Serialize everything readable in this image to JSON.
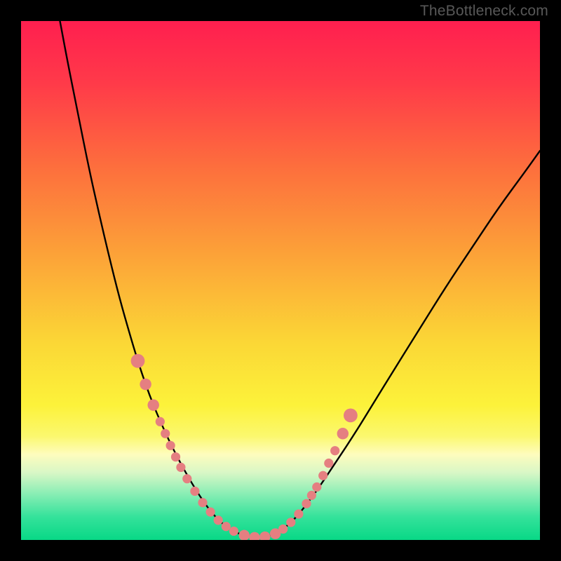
{
  "watermark": "TheBottleneck.com",
  "colors": {
    "frame": "#000000",
    "gradient_stops": [
      {
        "offset": 0.0,
        "color": "#ff1f4f"
      },
      {
        "offset": 0.12,
        "color": "#ff3a49"
      },
      {
        "offset": 0.28,
        "color": "#fd6e3d"
      },
      {
        "offset": 0.45,
        "color": "#fca238"
      },
      {
        "offset": 0.62,
        "color": "#fbd736"
      },
      {
        "offset": 0.74,
        "color": "#fcf23a"
      },
      {
        "offset": 0.8,
        "color": "#fbf86e"
      },
      {
        "offset": 0.835,
        "color": "#fefcbd"
      },
      {
        "offset": 0.87,
        "color": "#d9f7c6"
      },
      {
        "offset": 0.91,
        "color": "#8beeb5"
      },
      {
        "offset": 0.955,
        "color": "#35e29b"
      },
      {
        "offset": 1.0,
        "color": "#08d886"
      }
    ],
    "curve": "#000000",
    "marker_fill": "#e57f81",
    "marker_stroke": "#e57f81"
  },
  "chart_data": {
    "type": "line",
    "title": "",
    "xlabel": "",
    "ylabel": "",
    "xlim": [
      0,
      1
    ],
    "ylim": [
      0,
      1
    ],
    "note": "Axes are normalized to the plot area; no tick labels are rendered.",
    "series": [
      {
        "name": "bottleneck-curve",
        "x": [
          0.075,
          0.09,
          0.11,
          0.13,
          0.15,
          0.17,
          0.19,
          0.21,
          0.225,
          0.24,
          0.255,
          0.27,
          0.285,
          0.3,
          0.315,
          0.33,
          0.345,
          0.36,
          0.375,
          0.39,
          0.4,
          0.415,
          0.43,
          0.45,
          0.47,
          0.49,
          0.515,
          0.54,
          0.57,
          0.6,
          0.64,
          0.68,
          0.72,
          0.77,
          0.82,
          0.87,
          0.92,
          0.97,
          1.0
        ],
        "y": [
          1.0,
          0.92,
          0.82,
          0.72,
          0.63,
          0.545,
          0.465,
          0.395,
          0.345,
          0.3,
          0.26,
          0.225,
          0.192,
          0.162,
          0.134,
          0.108,
          0.084,
          0.062,
          0.044,
          0.03,
          0.023,
          0.014,
          0.009,
          0.005,
          0.006,
          0.012,
          0.028,
          0.055,
          0.095,
          0.14,
          0.2,
          0.265,
          0.33,
          0.41,
          0.49,
          0.565,
          0.64,
          0.708,
          0.75
        ]
      }
    ],
    "markers": {
      "name": "highlighted-points",
      "x": [
        0.225,
        0.24,
        0.255,
        0.268,
        0.278,
        0.288,
        0.298,
        0.308,
        0.32,
        0.335,
        0.35,
        0.365,
        0.38,
        0.395,
        0.41,
        0.43,
        0.45,
        0.47,
        0.49,
        0.505,
        0.52,
        0.535,
        0.55,
        0.56,
        0.57,
        0.582,
        0.593,
        0.605,
        0.62,
        0.635
      ],
      "y": [
        0.345,
        0.3,
        0.26,
        0.228,
        0.205,
        0.182,
        0.16,
        0.14,
        0.118,
        0.094,
        0.072,
        0.054,
        0.038,
        0.026,
        0.017,
        0.009,
        0.005,
        0.006,
        0.012,
        0.021,
        0.034,
        0.05,
        0.07,
        0.086,
        0.102,
        0.124,
        0.148,
        0.172,
        0.205,
        0.24
      ],
      "r": [
        18,
        15,
        15,
        12,
        12,
        12,
        12,
        12,
        12,
        12,
        12,
        12,
        12,
        12,
        12,
        14,
        14,
        14,
        14,
        12,
        12,
        12,
        12,
        12,
        12,
        12,
        12,
        12,
        15,
        18
      ]
    }
  }
}
